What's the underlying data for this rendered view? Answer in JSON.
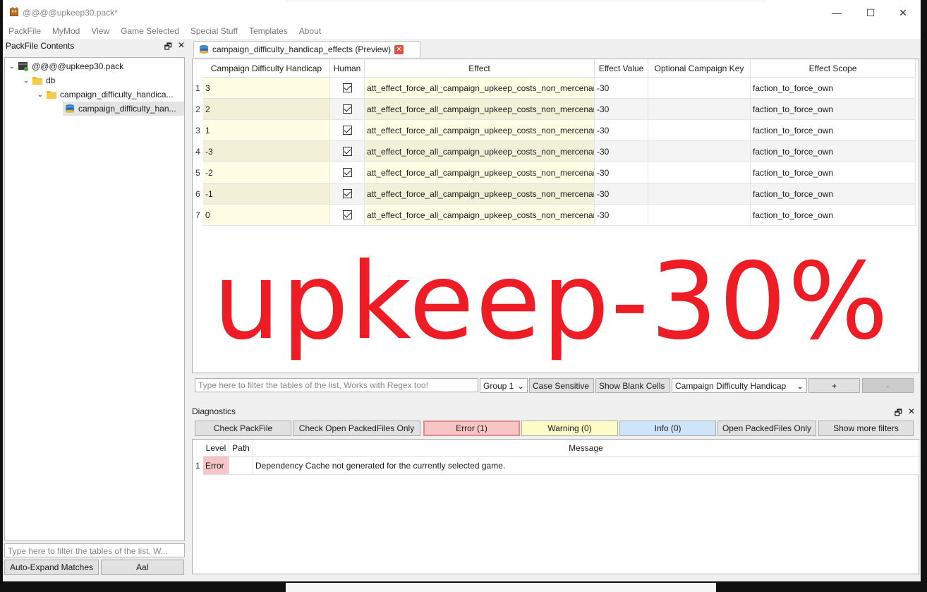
{
  "window": {
    "title": "@@@@upkeep30.pack*",
    "minimize_glyph": "—",
    "maximize_glyph": "☐",
    "close_glyph": "✕"
  },
  "menu": [
    "PackFile",
    "MyMod",
    "View",
    "Game Selected",
    "Special Stuff",
    "Templates",
    "About"
  ],
  "left_panel": {
    "title": "PackFile Contents",
    "float_glyph": "🗗",
    "close_glyph": "✕",
    "tree": [
      {
        "label": "@@@@upkeep30.pack",
        "icon": "pack-icon",
        "expanded": true
      },
      {
        "label": "db",
        "icon": "folder-icon",
        "expanded": true
      },
      {
        "label": "campaign_difficulty_handica...",
        "icon": "folder-icon",
        "expanded": true
      },
      {
        "label": "campaign_difficulty_han...",
        "icon": "db-table-icon",
        "selected": true
      }
    ],
    "filter_placeholder": "Type here to filter the tables of the list, W...",
    "auto_expand_label": "Auto-Expand Matches",
    "aai_label": "AaI"
  },
  "tab": {
    "label": "campaign_difficulty_handicap_effects (Preview)",
    "close_glyph": "✕"
  },
  "table": {
    "columns": [
      "Campaign Difficulty Handicap",
      "Human",
      "Effect",
      "Effect Value",
      "Optional Campaign Key",
      "Effect Scope"
    ],
    "rows": [
      {
        "n": "1",
        "handicap": "3",
        "human": true,
        "effect": "att_effect_force_all_campaign_upkeep_costs_non_mercenary",
        "value": "-30",
        "key": "",
        "scope": "faction_to_force_own"
      },
      {
        "n": "2",
        "handicap": "2",
        "human": true,
        "effect": "att_effect_force_all_campaign_upkeep_costs_non_mercenary",
        "value": "-30",
        "key": "",
        "scope": "faction_to_force_own"
      },
      {
        "n": "3",
        "handicap": "1",
        "human": true,
        "effect": "att_effect_force_all_campaign_upkeep_costs_non_mercenary",
        "value": "-30",
        "key": "",
        "scope": "faction_to_force_own"
      },
      {
        "n": "4",
        "handicap": "-3",
        "human": true,
        "effect": "att_effect_force_all_campaign_upkeep_costs_non_mercenary",
        "value": "-30",
        "key": "",
        "scope": "faction_to_force_own"
      },
      {
        "n": "5",
        "handicap": "-2",
        "human": true,
        "effect": "att_effect_force_all_campaign_upkeep_costs_non_mercenary",
        "value": "-30",
        "key": "",
        "scope": "faction_to_force_own"
      },
      {
        "n": "6",
        "handicap": "-1",
        "human": true,
        "effect": "att_effect_force_all_campaign_upkeep_costs_non_mercenary",
        "value": "-30",
        "key": "",
        "scope": "faction_to_force_own"
      },
      {
        "n": "7",
        "handicap": "0",
        "human": true,
        "effect": "att_effect_force_all_campaign_upkeep_costs_non_mercenary",
        "value": "-30",
        "key": "",
        "scope": "faction_to_force_own"
      }
    ],
    "overlay_text": "upkeep-30%",
    "overlay_color": "#ee1c25"
  },
  "filter_bar": {
    "placeholder": "Type here to filter the tables of the list, Works with Regex too!",
    "group": "Group 1",
    "case_sensitive": "Case Sensitive",
    "show_blank": "Show Blank Cells",
    "column": "Campaign Difficulty Handicap",
    "add": "+",
    "remove": "-"
  },
  "diagnostics": {
    "title": "Diagnostics",
    "buttons": {
      "check_packfile": "Check PackFile",
      "check_open": "Check Open PackedFiles Only",
      "error": "Error (1)",
      "warning": "Warning (0)",
      "info": "Info (0)",
      "open_only": "Open PackedFiles Only",
      "more_filters": "Show more filters"
    },
    "columns": [
      "Level",
      "Path",
      "Message"
    ],
    "rows": [
      {
        "n": "1",
        "level": "Error",
        "path": "",
        "message": "Dependency Cache not generated for the currently selected game."
      }
    ]
  }
}
